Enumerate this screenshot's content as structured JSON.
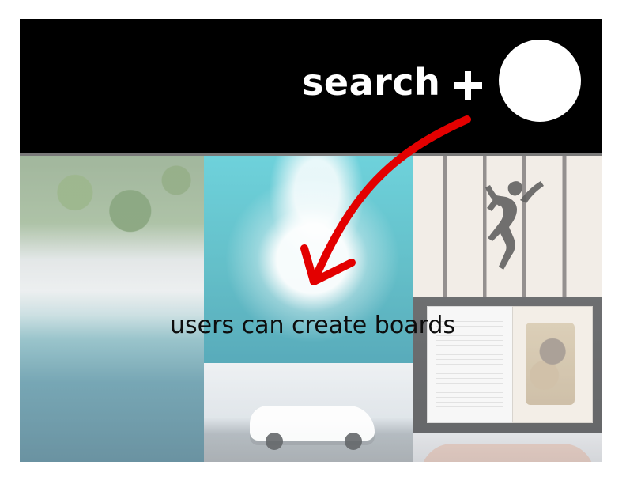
{
  "header": {
    "search_label": "search",
    "create_label": "+",
    "avatar": "profile"
  },
  "annotation": {
    "text": "users can create boards",
    "arrow_color": "#e30000"
  },
  "colors": {
    "topbar": "#000000",
    "topbar_text": "#ffffff",
    "divider": "#7a7a7a"
  }
}
